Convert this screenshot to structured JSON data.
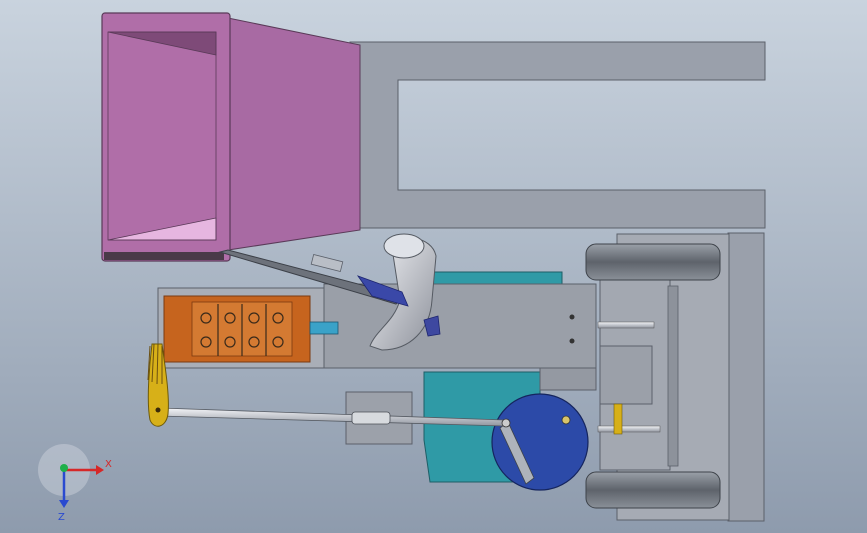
{
  "viewport": {
    "background_top": "#c9d3de",
    "background_bottom": "#8e9bad"
  },
  "colors": {
    "frame": "#9aa0ab",
    "frame_edge": "#5b606a",
    "hopper": "#b06ea8",
    "hopper_light": "#e6b6e0",
    "body": "#9a9fa8",
    "motor": "#c6641e",
    "teal": "#2f9aa6",
    "blue_disc": "#2c4aa8",
    "wheel": "#6f757e",
    "elbow": "#c9ccd4",
    "yellow": "#d7b018",
    "bracket": "#3a48a8"
  },
  "triad": {
    "x_label": "X",
    "z_label": "Z",
    "x_color": "#d62828",
    "y_color": "#1fb04a",
    "z_color": "#2a4ad0"
  }
}
